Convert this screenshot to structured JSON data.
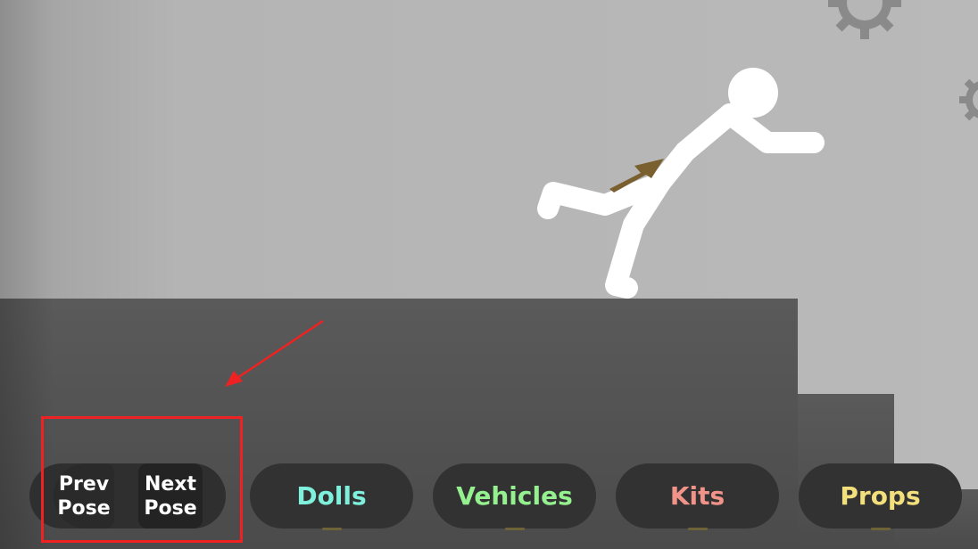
{
  "toolbar": {
    "prev_pose_label": "Prev\nPose",
    "next_pose_label": "Next\nPose",
    "categories": [
      {
        "label": "Dolls",
        "color": "#7ef0dc"
      },
      {
        "label": "Vehicles",
        "color": "#95f08f"
      },
      {
        "label": "Kits",
        "color": "#f2938a"
      },
      {
        "label": "Props",
        "color": "#f3df7c"
      }
    ]
  },
  "colors": {
    "background": "#b9b9b9",
    "platform": "#525252",
    "button_bg": "#323232",
    "annotation_red": "#ee2222",
    "gear": "#888888",
    "figure": "#ffffff",
    "pose_arrow": "#7a5f2f"
  },
  "annotation": {
    "highlight": "pose-buttons",
    "arrow_points_to": "pose-buttons"
  }
}
